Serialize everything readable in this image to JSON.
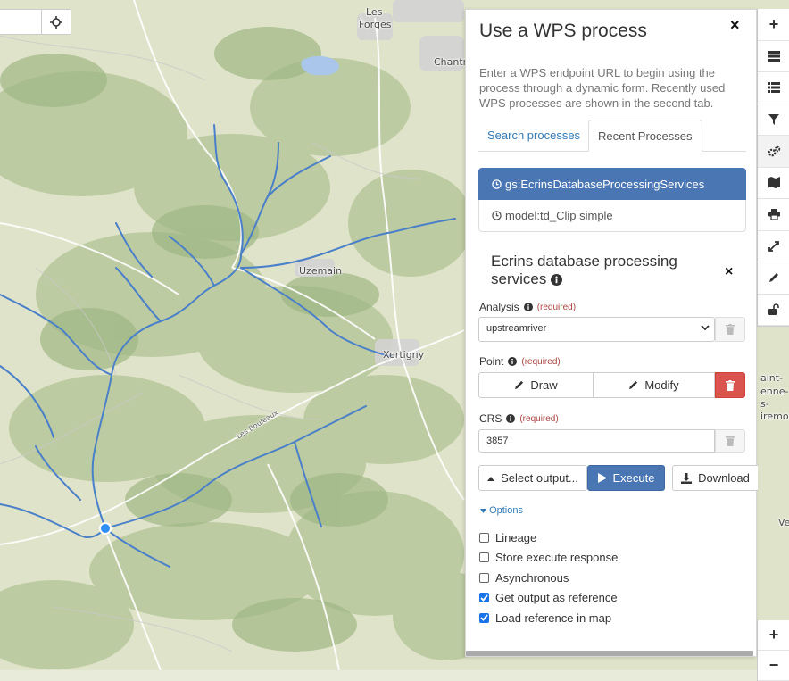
{
  "map": {
    "labels": {
      "les": "Les",
      "forges": "Forges",
      "chantraine": "Chantra",
      "uzemain": "Uzemain",
      "xertigny": "Xertigny",
      "road": "Les Bouleaux",
      "saint": "aint-",
      "etienne": "enne-",
      "les_re": "s-",
      "remiremont": "iremont",
      "ve": "Ve"
    },
    "search_value": ""
  },
  "toolbar": {
    "buttons": [
      "zoom-in",
      "layers",
      "list",
      "filter",
      "wps-gears",
      "map",
      "print",
      "fullscreen",
      "pencil",
      "unlock"
    ],
    "zoom_in": "+",
    "zoom_out": "−"
  },
  "panel": {
    "title": "Use a WPS process",
    "close": "×",
    "intro": "Enter a WPS endpoint URL to begin using the process through a dynamic form. Recently used WPS processes are shown in the second tab.",
    "tabs": [
      {
        "label": "Search processes",
        "active": false
      },
      {
        "label": "Recent Processes",
        "active": true
      }
    ],
    "recent": [
      {
        "label": "gs:EcrinsDatabaseProcessingServices",
        "active": true
      },
      {
        "label": "model:td_Clip simple",
        "active": false
      }
    ],
    "process": {
      "title": "Ecrins database processing services",
      "close": "×"
    },
    "analysis": {
      "label": "Analysis",
      "required": "(required)",
      "value": "upstreamriver"
    },
    "point": {
      "label": "Point",
      "required": "(required)",
      "draw": "Draw",
      "modify": "Modify"
    },
    "crs": {
      "label": "CRS",
      "required": "(required)",
      "value": "3857"
    },
    "actions": {
      "select_output": "Select output...",
      "execute": "Execute",
      "download": "Download"
    },
    "options": {
      "toggle": "Options",
      "items": [
        {
          "label": "Lineage",
          "checked": false
        },
        {
          "label": "Store execute response",
          "checked": false
        },
        {
          "label": "Asynchronous",
          "checked": false
        },
        {
          "label": "Get output as reference",
          "checked": true
        },
        {
          "label": "Load reference in map",
          "checked": true
        }
      ]
    }
  },
  "colors": {
    "primary": "#4a76b4",
    "danger": "#d9534f",
    "link": "#337ab7",
    "required": "#a94442",
    "river": "#4a7fc9"
  }
}
